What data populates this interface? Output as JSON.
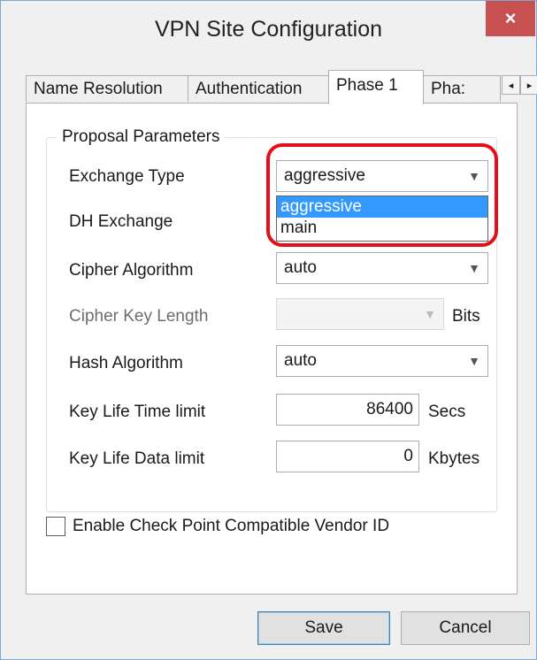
{
  "window": {
    "title": "VPN Site Configuration",
    "close_glyph": "×"
  },
  "tabs": [
    {
      "label": "Name Resolution",
      "active": false
    },
    {
      "label": "Authentication",
      "active": false
    },
    {
      "label": "Phase 1",
      "active": true
    },
    {
      "label": "Pha:",
      "active": false
    }
  ],
  "tab_scroll": {
    "left": "◂",
    "right": "▸"
  },
  "group": {
    "legend": "Proposal Parameters"
  },
  "fields": {
    "exchange_type": {
      "label": "Exchange Type",
      "value": "aggressive",
      "options": [
        "aggressive",
        "main"
      ],
      "highlighted_option": "aggressive"
    },
    "dh_exchange": {
      "label": "DH Exchange"
    },
    "cipher_algorithm": {
      "label": "Cipher Algorithm",
      "value": "auto"
    },
    "cipher_key_length": {
      "label": "Cipher Key Length",
      "value": "",
      "unit": "Bits",
      "disabled": true
    },
    "hash_algorithm": {
      "label": "Hash Algorithm",
      "value": "auto"
    },
    "key_life_time": {
      "label": "Key Life Time limit",
      "value": "86400",
      "unit": "Secs"
    },
    "key_life_data": {
      "label": "Key Life Data limit",
      "value": "0",
      "unit": "Kbytes"
    }
  },
  "checkbox": {
    "label": "Enable Check Point Compatible Vendor ID",
    "checked": false
  },
  "buttons": {
    "save": "Save",
    "cancel": "Cancel"
  },
  "icons": {
    "chevron": "chevron-down-icon",
    "close": "close-icon"
  },
  "colors": {
    "highlight": "#e3101c",
    "selection": "#3399ff",
    "close_button": "#c75050"
  }
}
